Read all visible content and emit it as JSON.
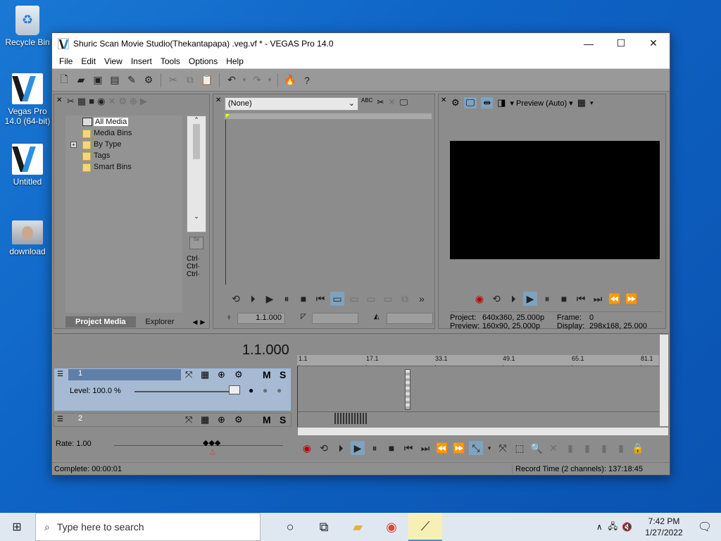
{
  "desktop": {
    "icons": [
      {
        "label": "Recycle Bin",
        "icon": "recycle-bin-icon"
      },
      {
        "label": "Vegas Pro 14.0 (64-bit)",
        "icon": "vegas-icon"
      },
      {
        "label": "Untitled",
        "icon": "vegas-file-icon"
      },
      {
        "label": "download",
        "icon": "image-file-icon"
      }
    ]
  },
  "window": {
    "title": "Shuric Scan Movie Studio(Thekantapapa) .veg.vf * - VEGAS Pro 14.0",
    "controls": {
      "minimize": "—",
      "maximize": "☐",
      "close": "✕"
    }
  },
  "menu": [
    "File",
    "Edit",
    "View",
    "Insert",
    "Tools",
    "Options",
    "Help"
  ],
  "project_media": {
    "tree": [
      "All Media",
      "Media Bins",
      "By Type",
      "Tags",
      "Smart Bins"
    ],
    "side_labels": [
      "Ctrl·",
      "Ctrl·",
      "Ctrl·"
    ],
    "tabs": {
      "active": "Project Media",
      "other": "Explorer"
    }
  },
  "trimmer": {
    "dropdown": "(None)",
    "timecode": "1.1.000"
  },
  "preview": {
    "mode": "Preview (Auto)",
    "project_label": "Project:",
    "project_value": "640x360, 25.000p",
    "preview_label": "Preview:",
    "preview_value": "160x90, 25.000p",
    "frame_label": "Frame:",
    "frame_value": "0",
    "display_label": "Display:",
    "display_value": "298x168, 25.000"
  },
  "timeline": {
    "cursor": "1.1.000",
    "ruler": [
      "1.1",
      "17.1",
      "33.1",
      "49.1",
      "65.1",
      "81.1"
    ],
    "tracks": [
      {
        "number": "1",
        "level": "Level: 100.0 %"
      },
      {
        "number": "2"
      }
    ],
    "rate": "Rate: 1.00",
    "mute": "M",
    "solo": "S"
  },
  "status": {
    "left": "Complete: 00:00:01",
    "right": "Record Time (2 channels): 137:18:45"
  },
  "taskbar": {
    "search_placeholder": "Type here to search",
    "time": "7:42 PM",
    "date": "1/27/2022"
  },
  "colors": {
    "track_bg": "#a6bad3",
    "accent": "#4a90e2"
  }
}
